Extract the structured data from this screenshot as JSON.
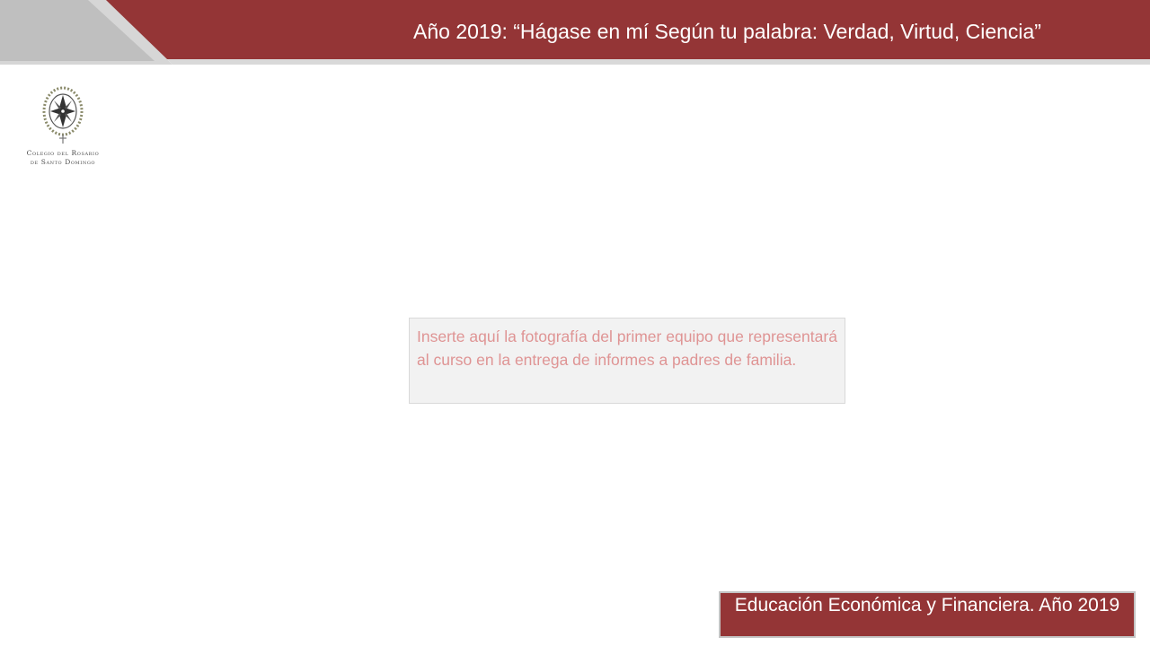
{
  "header": {
    "title": "Año 2019: “Hágase en mí Según tu palabra: Verdad, Virtud, Ciencia”"
  },
  "logo": {
    "line1": "Colegio del Rosario",
    "line2": "de Santo Domingo"
  },
  "placeholder": {
    "text": "Inserte aquí la fotografía del primer equipo que representará al curso en la entrega de informes a padres de familia."
  },
  "footer": {
    "text": "Educación Económica y Financiera. Año 2019"
  },
  "colors": {
    "brand_red": "#943536",
    "header_gray": "#c8c8c8",
    "placeholder_text": "#df9494",
    "placeholder_bg": "#f2f2f2"
  }
}
